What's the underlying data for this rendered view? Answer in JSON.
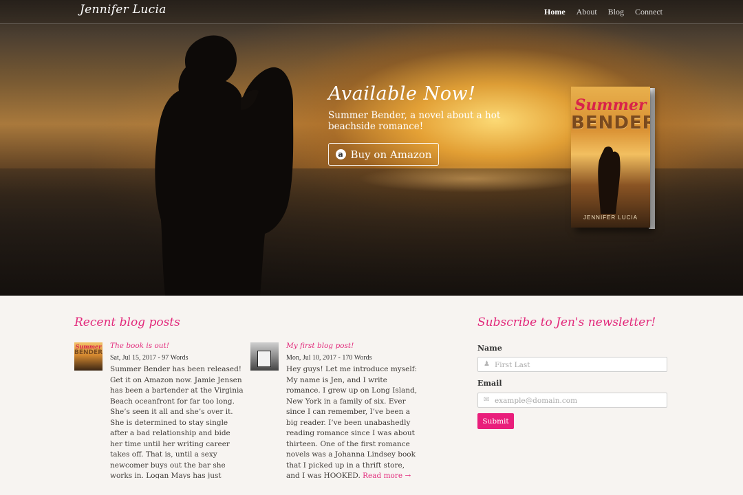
{
  "site": {
    "brand": "Jennifer Lucia"
  },
  "nav": {
    "items": [
      "Home",
      "About",
      "Blog",
      "Connect"
    ]
  },
  "hero": {
    "title": "Available Now!",
    "subtitle": "Summer Bender, a novel about a hot beachside romance!",
    "button_label": "Buy on Amazon",
    "button_icon": "amazon-icon"
  },
  "book": {
    "title_line1": "Summer",
    "title_line2": "BENDER",
    "author": "JENNIFER LUCIA"
  },
  "blog": {
    "heading": "Recent blog posts",
    "posts": [
      {
        "title": "The book is out!",
        "meta": "Sat, Jul 15, 2017 - 97 Words",
        "thumb_title_line1": "Summer",
        "thumb_title_line2": "BENDER",
        "body": "Summer Bender has been released! Get it on Amazon now. Jamie Jensen has been a bartender at the Virginia Beach oceanfront for far too long. She’s seen it all and she’s over it. She is determined to stay single after a bad relationship and bide her time until her writing career takes off. That is, until a sexy newcomer buys out the bar she works in. Logan Mays has just bought Bender’s Bar,"
      },
      {
        "title": "My first blog post!",
        "meta": "Mon, Jul 10, 2017 - 170 Words",
        "body": "Hey guys! Let me introduce myself: My name is Jen, and I write romance. I grew up on Long Island, New York in a family of six. Ever since I can remember, I’ve been a big reader. I’ve been unabashedly reading romance since I was about thirteen. One of the first romance novels was a Johanna Lindsey book that I picked up in a thrift store, and I was HOOKED.",
        "read_more": "Read more →"
      }
    ]
  },
  "newsletter": {
    "heading": "Subscribe to Jen's newsletter!",
    "name_label": "Name",
    "name_placeholder": "First Last",
    "name_icon": "user-icon",
    "email_label": "Email",
    "email_placeholder": "example@domain.com",
    "email_icon": "envelope-icon",
    "submit_label": "Submit",
    "accent_color": "#e91e7b"
  }
}
